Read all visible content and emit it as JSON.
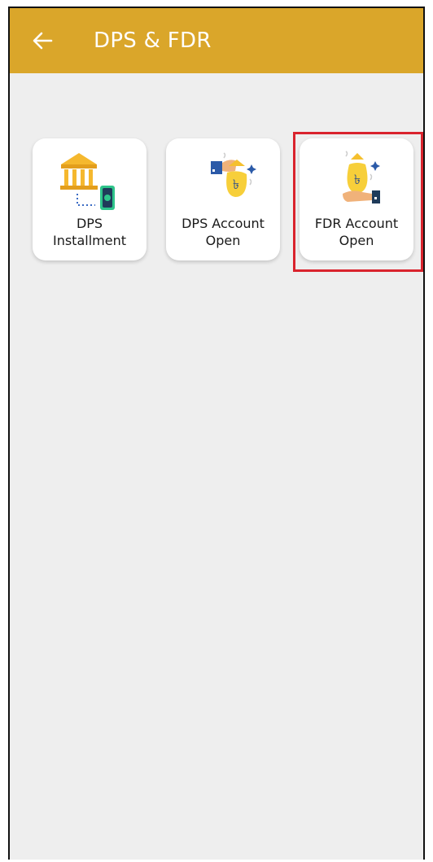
{
  "appbar": {
    "back_icon": "arrow-left-icon",
    "title": "DPS & FDR",
    "color": "#DAA62A"
  },
  "tiles": [
    {
      "label": "DPS\nInstallment",
      "icon": "bank-cash-icon"
    },
    {
      "label": "DPS Account\nOpen",
      "icon": "money-bag-give-icon"
    },
    {
      "label": "FDR Account\nOpen",
      "icon": "money-bag-hand-icon"
    }
  ],
  "highlight": {
    "target": "FDR Account Open",
    "color": "#D9232D"
  }
}
